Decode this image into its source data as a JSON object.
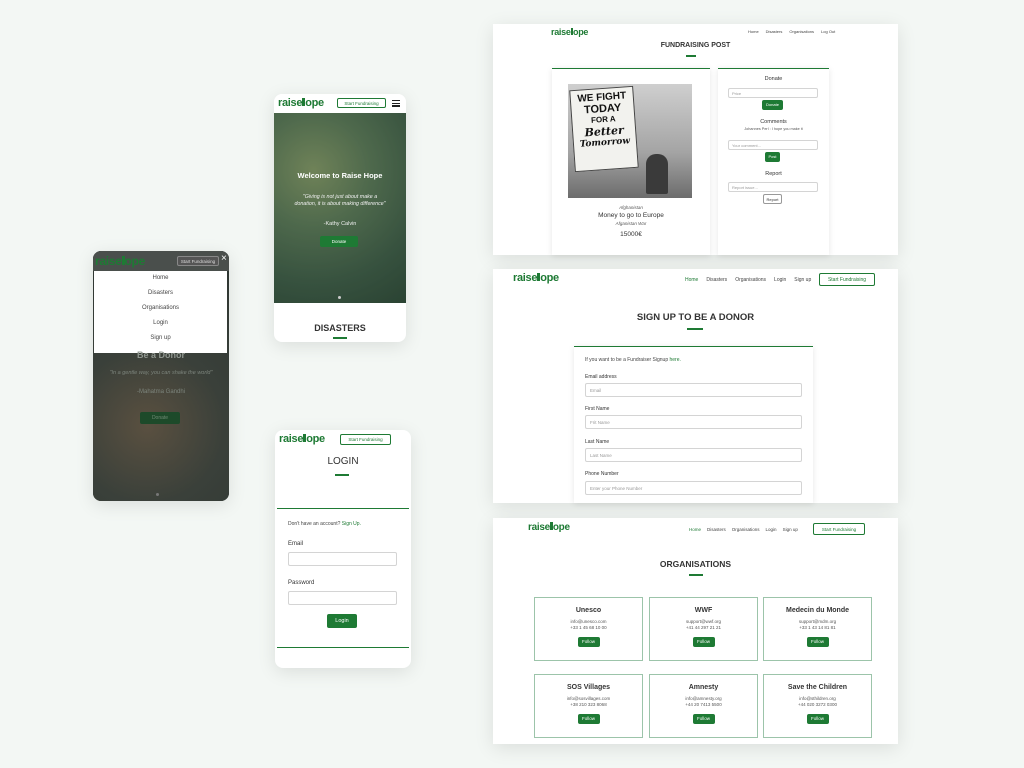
{
  "brand": {
    "logo_left": "raise",
    "logo_right": "ope"
  },
  "colors": {
    "accent": "#1e7a34",
    "background": "#f3f7f4"
  },
  "phone_menu": {
    "cta": "Start Fundraising",
    "close_icon": "×",
    "menu_items": [
      "Home",
      "Disasters",
      "Organisations",
      "Login",
      "Sign up"
    ],
    "heading": "Be a Donor",
    "quote": "\"In a gentle way, you can shake the world\"",
    "author": "-Mahatma Gandhi",
    "donate": "Donate"
  },
  "phone_home": {
    "cta": "Start Fundraising",
    "menu_icon": "hamburger-icon",
    "title": "Welcome to Raise Hope",
    "quote": "\"Giving is not just about make a donation, it is about making difference\"",
    "author": "-Kathy Calvin",
    "donate": "Donate",
    "section": "DISASTERS"
  },
  "phone_login": {
    "cta": "Start Fundraising",
    "title": "LOGIN",
    "prompt": "Don't have an account?",
    "signup_link": "Sign Up.",
    "email_label": "Email",
    "password_label": "Password",
    "login_button": "Login"
  },
  "desk_post": {
    "nav": [
      "Home",
      "Disasters",
      "Organisations",
      "Log Out"
    ],
    "title": "FUNDRAISING POST",
    "sign_lines": [
      "WE FIGHT",
      "TODAY",
      "FOR A",
      "Better",
      "Tomorrow"
    ],
    "country": "Afghanistan",
    "post_title": "Money to go to Europe",
    "subtitle": "Afganistan War",
    "amount": "15000€",
    "donate_heading": "Donate",
    "price_placeholder": "Price",
    "donate_button": "Donate",
    "comments_heading": "Comments",
    "comment_text": "Johannes Perl : I hope you make it",
    "comment_placeholder": "Your comment...",
    "post_button": "Post",
    "report_heading": "Report",
    "report_placeholder": "Report issue...",
    "report_button": "Report"
  },
  "desk_signup": {
    "nav": [
      "Home",
      "Disasters",
      "Organisations",
      "Login",
      "Sign up"
    ],
    "cta": "Start Fundraising",
    "title": "SIGN UP TO BE A DONOR",
    "intro": "If you want to be a Fundraiser Signup",
    "intro_link": "here.",
    "email_label": "Email address",
    "email_placeholder": "Email",
    "first_label": "First Name",
    "first_placeholder": "Frit Name",
    "last_label": "Last Name",
    "last_placeholder": "Last Name",
    "phone_label": "Phone Number",
    "phone_placeholder": "Enter your Phone Number"
  },
  "desk_orgs": {
    "nav": [
      "Home",
      "Disasters",
      "Organisations",
      "Login",
      "Sign up"
    ],
    "cta": "Start Fundraising",
    "title": "ORGANISATIONS",
    "follow": "Follow",
    "orgs": [
      {
        "name": "Unesco",
        "email": "info@unesco.com",
        "phone": "+33 1 45 68 10 00"
      },
      {
        "name": "WWF",
        "email": "support@wwf.org",
        "phone": "+41 44 297 21 21"
      },
      {
        "name": "Medecin du Monde",
        "email": "support@mdm.org",
        "phone": "+33 1 43 14 81 81"
      },
      {
        "name": "SOS Villages",
        "email": "info@sosvillages.com",
        "phone": "+38 210 323 8068"
      },
      {
        "name": "Amnesty",
        "email": "info@amnesty.org",
        "phone": "+44 20 7413 5500"
      },
      {
        "name": "Save the Children",
        "email": "info@sthildren.org",
        "phone": "+44 020 3272 0300"
      }
    ]
  }
}
